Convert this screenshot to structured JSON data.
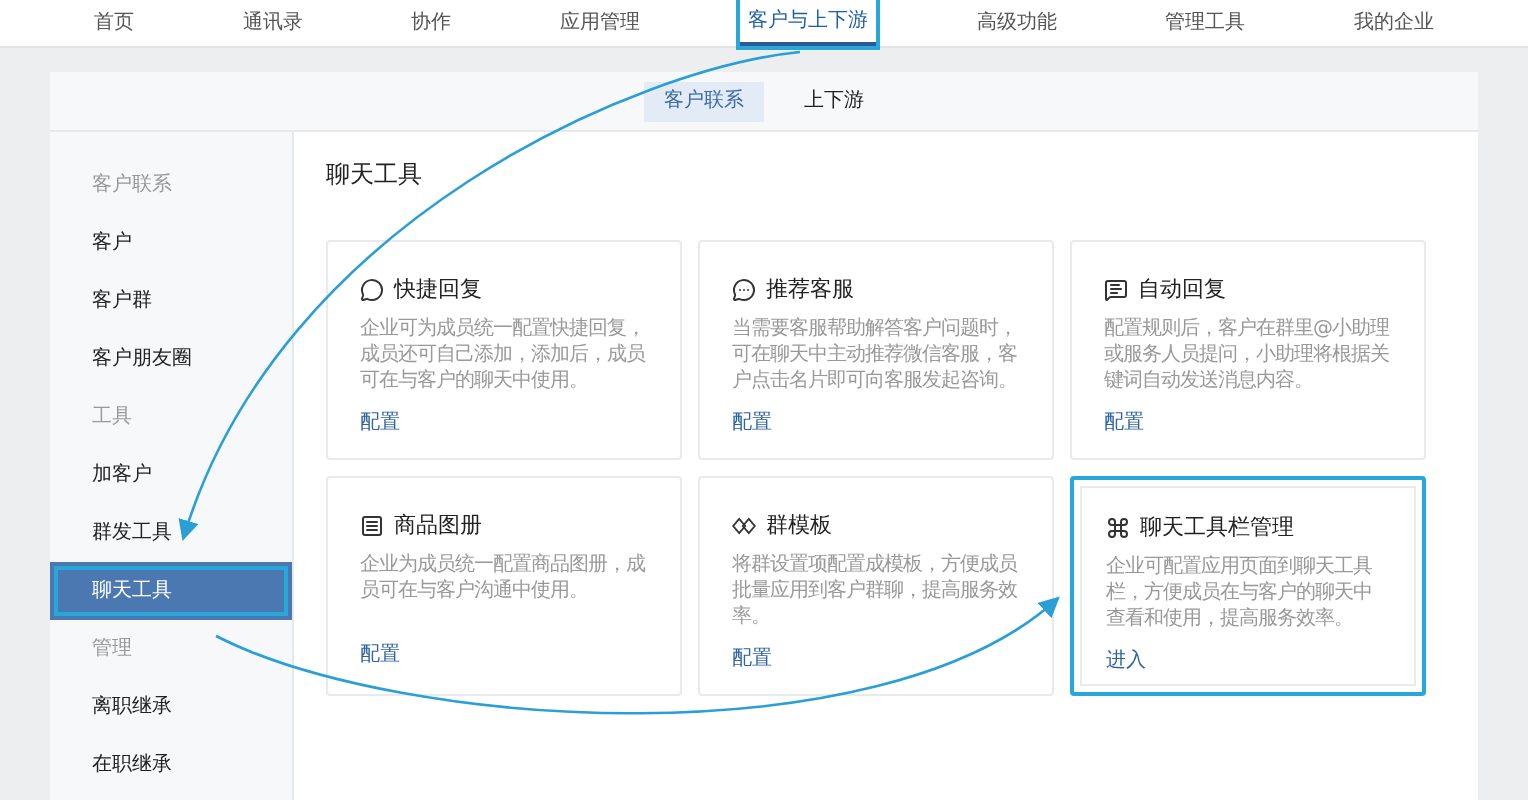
{
  "nav": [
    {
      "label": "首页",
      "selected": false,
      "highlighted": false
    },
    {
      "label": "通讯录",
      "selected": false,
      "highlighted": false
    },
    {
      "label": "协作",
      "selected": false,
      "highlighted": false
    },
    {
      "label": "应用管理",
      "selected": false,
      "highlighted": false
    },
    {
      "label": "客户与上下游",
      "selected": true,
      "highlighted": true
    },
    {
      "label": "高级功能",
      "selected": false,
      "highlighted": false
    },
    {
      "label": "管理工具",
      "selected": false,
      "highlighted": false
    },
    {
      "label": "我的企业",
      "selected": false,
      "highlighted": false
    }
  ],
  "subtabs": [
    {
      "label": "客户联系",
      "selected": true
    },
    {
      "label": "上下游",
      "selected": false
    }
  ],
  "sidebar": [
    {
      "heading": "客户联系",
      "items": [
        {
          "label": "客户",
          "selected": false,
          "highlighted": false
        },
        {
          "label": "客户群",
          "selected": false,
          "highlighted": false
        },
        {
          "label": "客户朋友圈",
          "selected": false,
          "highlighted": false
        }
      ]
    },
    {
      "heading": "工具",
      "items": [
        {
          "label": "加客户",
          "selected": false,
          "highlighted": false
        },
        {
          "label": "群发工具",
          "selected": false,
          "highlighted": false
        },
        {
          "label": "聊天工具",
          "selected": true,
          "highlighted": true
        }
      ]
    },
    {
      "heading": "管理",
      "items": [
        {
          "label": "离职继承",
          "selected": false,
          "highlighted": false
        },
        {
          "label": "在职继承",
          "selected": false,
          "highlighted": false
        }
      ]
    }
  ],
  "content": {
    "title": "聊天工具",
    "cards": [
      {
        "title": "快捷回复",
        "description": "企业可为成员统一配置快捷回复，成员还可自己添加，添加后，成员可在与客户的聊天中使用。",
        "link": "配置",
        "highlighted": false
      },
      {
        "title": "推荐客服",
        "description": "当需要客服帮助解答客户问题时，可在聊天中主动推荐微信客服，客户点击名片即可向客服发起咨询。",
        "link": "配置",
        "highlighted": false
      },
      {
        "title": "自动回复",
        "description": "配置规则后，客户在群里@小助理或服务人员提问，小助理将根据关键词自动发送消息内容。",
        "link": "配置",
        "highlighted": false
      },
      {
        "title": "商品图册",
        "description": "企业为成员统一配置商品图册，成员可在与客户沟通中使用。",
        "link": "配置",
        "highlighted": false
      },
      {
        "title": "群模板",
        "description": "将群设置项配置成模板，方便成员批量应用到客户群聊，提高服务效率。",
        "link": "配置",
        "highlighted": false
      },
      {
        "title": "聊天工具栏管理",
        "description": "企业可配置应用页面到聊天工具栏，方便成员在与客户的聊天中查看和使用，提高服务效率。",
        "link": "进入",
        "highlighted": true
      }
    ]
  }
}
